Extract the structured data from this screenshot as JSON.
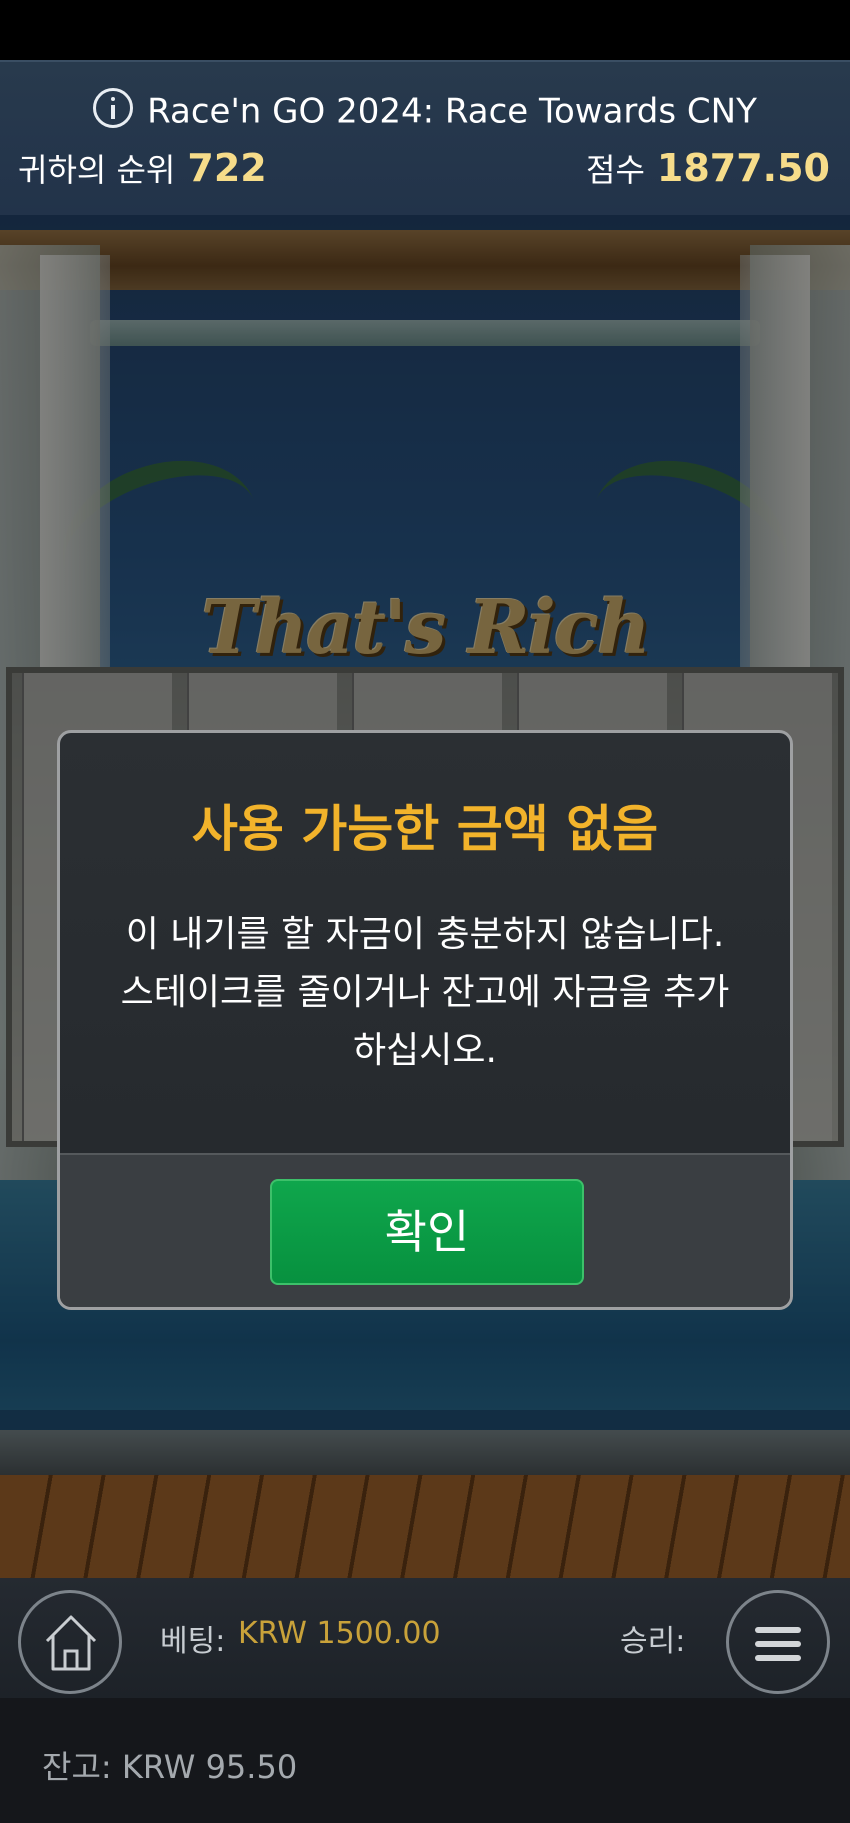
{
  "tournament": {
    "title": "Race'n GO 2024: Race Towards CNY",
    "rank_label": "귀하의 순위",
    "rank_value": "722",
    "score_label": "점수",
    "score_value": "1877.50",
    "info_icon": "info-icon"
  },
  "game": {
    "logo_text": "That's Rich"
  },
  "dialog": {
    "title": "사용 가능한 금액 없음",
    "message": "이 내기를 할 자금이 충분하지 않습니다. 스테이크를 줄이거나 잔고에 자금을 추가하십시오.",
    "ok_label": "확인"
  },
  "bottom_bar": {
    "home_icon": "home-icon",
    "bet_label": "베팅:",
    "bet_value": "KRW 1500.00",
    "win_label": "승리:",
    "menu_icon": "hamburger-menu-icon",
    "balance": "잔고: KRW 95.50"
  },
  "colors": {
    "accent_gold": "#f6dc8a",
    "title_orange": "#f2b32b",
    "ok_green": "#0fa64c",
    "bet_value_gold": "#c9a23a"
  }
}
